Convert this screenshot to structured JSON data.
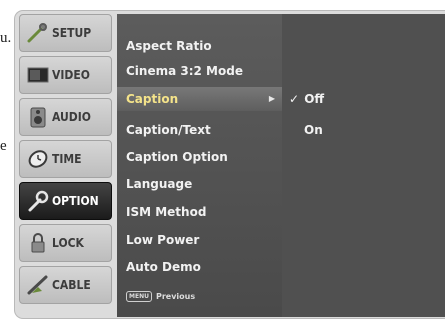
{
  "background_text": {
    "left_char_1": "u.",
    "left_char_2": "e"
  },
  "tabs": [
    {
      "label": "SETUP",
      "icon": "setup-icon",
      "active": false
    },
    {
      "label": "VIDEO",
      "icon": "video-icon",
      "active": false
    },
    {
      "label": "AUDIO",
      "icon": "audio-icon",
      "active": false
    },
    {
      "label": "TIME",
      "icon": "time-icon",
      "active": false
    },
    {
      "label": "OPTION",
      "icon": "option-icon",
      "active": true
    },
    {
      "label": "LOCK",
      "icon": "lock-icon",
      "active": false
    },
    {
      "label": "CABLE",
      "icon": "cable-icon",
      "active": false
    }
  ],
  "menu": {
    "items": [
      {
        "label": "Aspect Ratio"
      },
      {
        "label": "Cinema 3:2 Mode"
      },
      {
        "label": "Caption",
        "selected": true,
        "arrow": "▶"
      },
      {
        "label": "Caption/Text"
      },
      {
        "label": "Caption Option"
      },
      {
        "label": "Language"
      },
      {
        "label": "ISM Method"
      },
      {
        "label": "Low Power"
      },
      {
        "label": "Auto Demo"
      }
    ],
    "footer": {
      "key": "MENU",
      "text": "Previous"
    }
  },
  "submenu": {
    "options": [
      {
        "label": "Off",
        "check": "✓",
        "checked": true
      },
      {
        "label": "On",
        "check": "",
        "checked": false
      }
    ]
  },
  "colors": {
    "highlight_text": "#f4e38a",
    "panel": "#4e4e4e",
    "active_tab": "#222222"
  }
}
